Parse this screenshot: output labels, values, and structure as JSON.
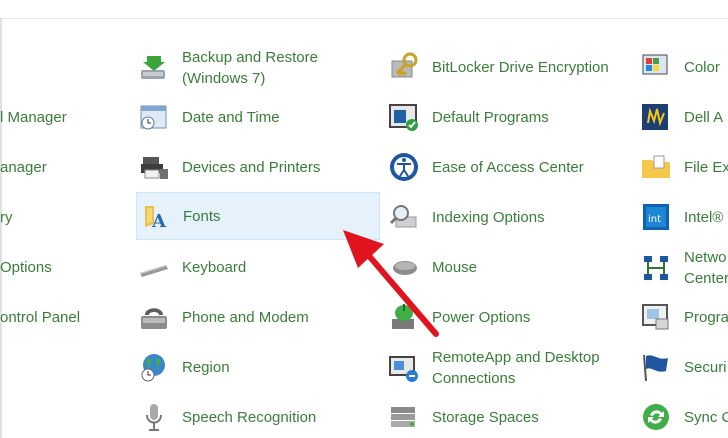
{
  "col0": [
    {
      "label": "l Manager"
    },
    {
      "label": "anager"
    },
    {
      "label": "ry"
    },
    {
      "label": "Options"
    },
    {
      "label": "ontrol Panel"
    }
  ],
  "col1": [
    {
      "label1": "Backup and Restore",
      "label2": "(Windows 7)"
    },
    {
      "label": "Date and Time"
    },
    {
      "label": "Devices and Printers"
    },
    {
      "label": "Fonts"
    },
    {
      "label": "Keyboard"
    },
    {
      "label": "Phone and Modem"
    },
    {
      "label": "Region"
    },
    {
      "label": "Speech Recognition"
    }
  ],
  "col2": [
    {
      "label": "BitLocker Drive Encryption"
    },
    {
      "label": "Default Programs"
    },
    {
      "label": "Ease of Access Center"
    },
    {
      "label": "Indexing Options"
    },
    {
      "label": "Mouse"
    },
    {
      "label": "Power Options"
    },
    {
      "label1": "RemoteApp and Desktop",
      "label2": "Connections"
    },
    {
      "label": "Storage Spaces"
    }
  ],
  "col3": [
    {
      "label": "Color"
    },
    {
      "label": "Dell A"
    },
    {
      "label": "File Ex"
    },
    {
      "label": "Intel®"
    },
    {
      "label1": "Netwo",
      "label2": "Center"
    },
    {
      "label": "Progra"
    },
    {
      "label": "Securi"
    },
    {
      "label": "Sync C"
    }
  ],
  "colors": {
    "link": "#3a7d3a",
    "selected_bg": "#e5f1fb",
    "arrow": "#e0141e"
  }
}
